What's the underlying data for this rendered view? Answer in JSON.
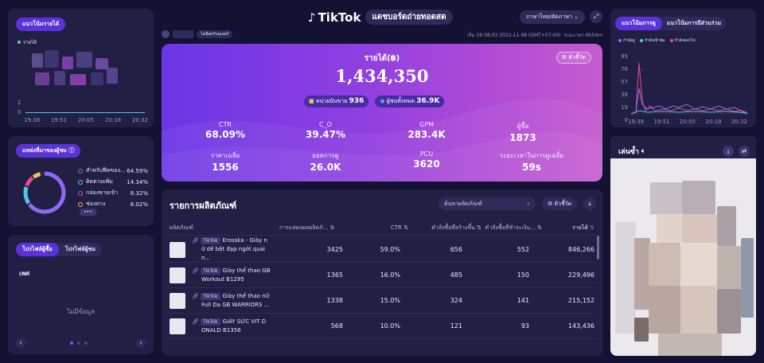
{
  "header": {
    "brand": "TikTok",
    "title": "แดชบอร์ดถ่ายทอดสด",
    "language": "ภาษาไทย/ตัดภาษา",
    "account_badge": "ไลฟ์สดกับนุเจอร์",
    "time_info": "เริ่ม 19:38:03 2022-11-08 (GMT+07:00)",
    "duration": "ระยะเวลา 6h54m"
  },
  "left_trend": {
    "tab_label": "แนวโน้มรายได้",
    "legend": "รายได้",
    "y_ticks": [
      "2",
      "0"
    ],
    "x_ticks": [
      "19:38",
      "19:51",
      "20:05",
      "20:18",
      "20:32"
    ]
  },
  "traffic_source": {
    "tab_label": "แหล่งที่มาของผู้ชม",
    "items": [
      {
        "label": "สำหรับฟีดของ...",
        "value": "64.59%",
        "color": "#8f6af0"
      },
      {
        "label": "ติดตามเพิ่ม",
        "value": "14.34%",
        "color": "#4ec9e8"
      },
      {
        "label": "กล่องขายเข้า",
        "value": "8.32%",
        "color": "#e94a8a"
      },
      {
        "label": "ช่องทาง",
        "value": "6.02%",
        "color": "#f2c14e"
      }
    ],
    "more_label": "•••"
  },
  "profile": {
    "tab_active": "โปรไฟล์ผู้ซื้อ",
    "tab_inactive": "โปรไฟล์ผู้ชม",
    "section": "เพศ",
    "empty": "ไม่มีข้อมูล"
  },
  "hero": {
    "revenue_label": "รายได้(฿)",
    "revenue_value": "1,434,350",
    "more_button": "ตัวชี้วัด",
    "units_label": "หน่วยนับขาย",
    "units_value": "936",
    "viewers_label": "ผู้ชมทั้งหมด",
    "viewers_value": "36.9K",
    "metrics": [
      {
        "label": "CTR",
        "value": "68.09%"
      },
      {
        "label": "C_O",
        "value": "39.47%"
      },
      {
        "label": "GPM",
        "value": "283.4K"
      },
      {
        "label": "ผู้ซื้อ",
        "value": "1873"
      },
      {
        "label": "ราคาเฉลี่ย",
        "value": "1556"
      },
      {
        "label": "ยอดการดู",
        "value": "26.0K"
      },
      {
        "label": "PCU",
        "value": "3620"
      },
      {
        "label": "ระยะเวลาในการดูเฉลี่ย",
        "value": "59s"
      }
    ]
  },
  "products": {
    "title": "รายการผลิตภัณฑ์",
    "search_placeholder": "ค้นหาผลิตภัณฑ์",
    "metrics_button": "ตัวชี้วัด",
    "columns": [
      "ผลิตภัณฑ์",
      "การแสดงผลผลิตภั...",
      "CTR",
      "คำสั่งซื้อที่สร้างขึ้น",
      "คำสั่งซื้อที่ชำระเงิน...",
      "รายได้"
    ],
    "tag": "TikTok",
    "rows": [
      {
        "name1": "Erosska - Giày n",
        "name2": "ữ dế bệt đạp ngót quai n...",
        "impressions": "3425",
        "ctr": "59.0%",
        "created": "656",
        "paid": "552",
        "revenue": "846,266"
      },
      {
        "name1": "Giày thể thao GB",
        "name2": "Workout B1295",
        "impressions": "1365",
        "ctr": "16.0%",
        "created": "485",
        "paid": "150",
        "revenue": "229,496"
      },
      {
        "name1": "Giày thể thao nữ",
        "name2": "Full Da GB WARRIORS ...",
        "impressions": "1338",
        "ctr": "15.0%",
        "created": "324",
        "paid": "141",
        "revenue": "215,152"
      },
      {
        "name1": "GIÀY SỨC VIT D",
        "name2": "ONALD B1356",
        "impressions": "568",
        "ctr": "10.0%",
        "created": "121",
        "paid": "93",
        "revenue": "143,436"
      }
    ]
  },
  "right_trend": {
    "tab_active": "แนวโน้มการดู",
    "tab_inactive": "แนวโน้มการมีส่วนร่วม",
    "legend": [
      "กำลังดู",
      "กำลังเข้าชม",
      "กำลังออกไป"
    ],
    "legend_colors": [
      "#8f6af0",
      "#4ec9e8",
      "#e94a8a"
    ],
    "y_ticks": [
      "95",
      "76",
      "57",
      "38",
      "19",
      "0"
    ],
    "x_ticks": [
      "19:38",
      "19:51",
      "20:05",
      "20:18",
      "20:32"
    ]
  },
  "replay": {
    "title": "เล่นซ้ำ"
  }
}
